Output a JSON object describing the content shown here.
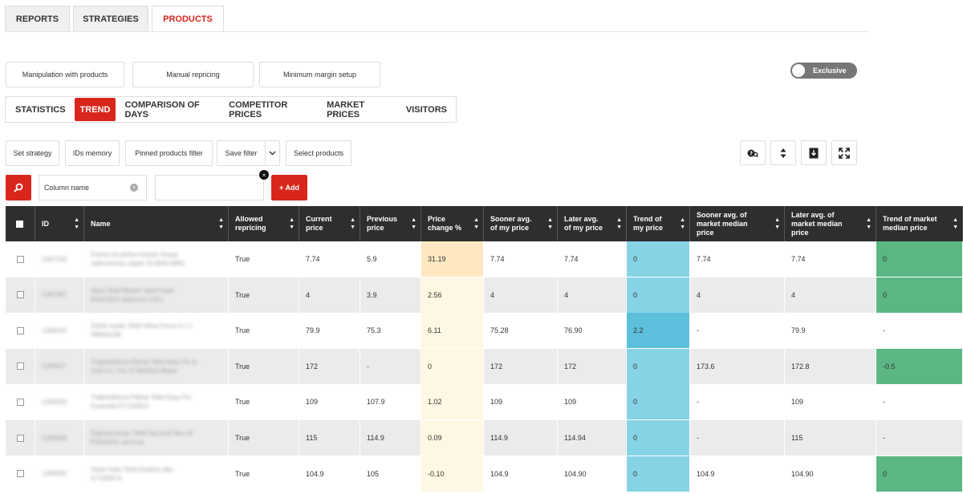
{
  "top_tabs": [
    {
      "label": "REPORTS"
    },
    {
      "label": "STRATEGIES"
    },
    {
      "label": "PRODUCTS"
    }
  ],
  "action_buttons": {
    "manipulation": "Manipulation with products",
    "manual_repricing": "Manual repricing",
    "minimum_margin": "Minimum margin setup"
  },
  "toggle": {
    "label": "Exclusive"
  },
  "sub_tabs": [
    {
      "label": "STATISTICS"
    },
    {
      "label": "TREND"
    },
    {
      "label": "COMPARISON OF DAYS"
    },
    {
      "label": "COMPETITOR PRICES"
    },
    {
      "label": "MARKET PRICES"
    },
    {
      "label": "VISITORS"
    }
  ],
  "toolbar": {
    "set_strategy": "Set strategy",
    "ids_memory": "IDs memory",
    "pinned_filter": "Pinned products filter",
    "save_filter": "Save filter",
    "select_products": "Select products"
  },
  "filter": {
    "column_value": "Column name",
    "add_label": "+ Add"
  },
  "table": {
    "headers": {
      "id": "ID",
      "name": "Name",
      "allowed_repricing": [
        "Allowed",
        "repricing"
      ],
      "current_price": [
        "Current",
        "price"
      ],
      "previous_price": [
        "Previous",
        "price"
      ],
      "price_change": [
        "Price",
        "change %"
      ],
      "sooner_avg": [
        "Sooner avg.",
        "of my price"
      ],
      "later_avg": [
        "Later avg.",
        "of my price"
      ],
      "trend_my": [
        "Trend of",
        "my price"
      ],
      "sooner_market": [
        "Sooner avg. of",
        "market median",
        "price"
      ],
      "later_market": [
        "Later avg. of",
        "market median",
        "price"
      ],
      "trend_market": [
        "Trend of market",
        "median price"
      ]
    },
    "rows": [
      {
        "id": "1267195",
        "name": [
          "Farma na pečivo Kaiser Grupa",
          "Jadrovnícka zápač 25 8565.8961"
        ],
        "allowed": "True",
        "current": "7.74",
        "previous": "5.9",
        "change": "31.19",
        "sooner": "7.74",
        "later": "7.74",
        "trend_my": "0",
        "sooner_mkt": "7.74",
        "later_mkt": "7.74",
        "trend_mkt": "0"
      },
      {
        "id": "1267087",
        "name": [
          "Stlza Tefal Master Seal Fresh",
          "K3021812 sklenenú 0.8 L"
        ],
        "allowed": "True",
        "current": "4",
        "previous": "3.9",
        "change": "2.56",
        "sooner": "4",
        "later": "4",
        "trend_my": "0",
        "sooner_mkt": "4",
        "later_mkt": "4",
        "trend_mkt": "0"
      },
      {
        "id": "1266502",
        "name": [
          "Žehlič mede Tefal Infina Force 4 v 1",
          "HB946138"
        ],
        "allowed": "True",
        "current": "79.9",
        "previous": "75.3",
        "change": "6.11",
        "sooner": "75.28",
        "later": "76.90",
        "trend_my": "2.2",
        "sooner_mkt": "-",
        "later_mkt": "79.9",
        "trend_mkt": "-"
      },
      {
        "id": "1266417",
        "name": [
          "Trajtonšíková Pálma Tefal Easy Fix &",
          "Grill 2v1 XXL EY801815 Black"
        ],
        "allowed": "True",
        "current": "172",
        "previous": "-",
        "change": "0",
        "sooner": "172",
        "later": "172",
        "trend_my": "0",
        "sooner_mkt": "173.6",
        "later_mkt": "172.8",
        "trend_mkt": "-0.5"
      },
      {
        "id": "1266333",
        "name": [
          "Trajtonšíková Pálma Tefal Easy Fry",
          "Essential EY130815"
        ],
        "allowed": "True",
        "current": "109",
        "previous": "107.9",
        "change": "1.02",
        "sooner": "109",
        "later": "109",
        "trend_my": "0",
        "sooner_mkt": "-",
        "later_mkt": "109",
        "trend_mkt": "-"
      },
      {
        "id": "1266638",
        "name": [
          "Žiakové hrnec Tefal Secure5 Neo 6l",
          "P2534041 set 6 ks"
        ],
        "allowed": "True",
        "current": "115",
        "previous": "114.9",
        "change": "0.09",
        "sooner": "114.9",
        "later": "114.94",
        "trend_my": "0",
        "sooner_mkt": "-",
        "later_mkt": "115",
        "trend_mkt": "-"
      },
      {
        "id": "1266582",
        "name": [
          "Sada riadu Tefal Duetton dky",
          "G719S674"
        ],
        "allowed": "True",
        "current": "104.9",
        "previous": "105",
        "change": "-0.10",
        "sooner": "104.9",
        "later": "104.90",
        "trend_my": "0",
        "sooner_mkt": "104.9",
        "later_mkt": "104.90",
        "trend_mkt": "0"
      }
    ]
  },
  "colors": {
    "accent": "#d9261c",
    "header_bg": "#2e2e2e",
    "change_col_bg": "#fdf7e3",
    "change_col_first": "#fde8c2",
    "trend_col_bg": "#87d3e6",
    "trend_col_strong": "#5cc0dc",
    "market_trend_green": "#5ab784",
    "row_even": "#ebebeb",
    "row_odd": "#ffffff"
  }
}
